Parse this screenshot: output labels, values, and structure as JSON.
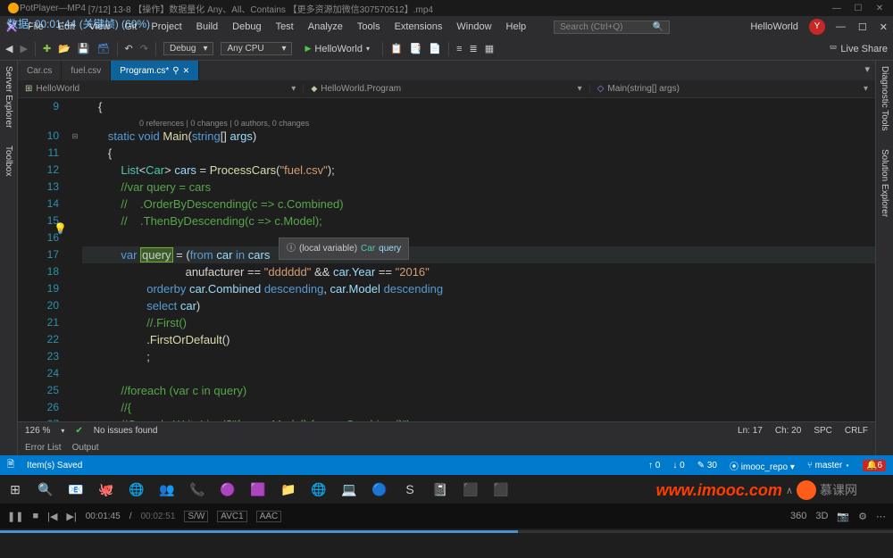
{
  "pot": {
    "app": "PotPlayer",
    "format": "MP4",
    "file": "[7/12] 13-8 【操作】数据量化 Any、All、Contains 【更多资源加微信307570512】.mp4"
  },
  "overlay": "数据: 00:01:44 (关键帧) (60%)",
  "menu": [
    "File",
    "Edit",
    "View",
    "Git",
    "Project",
    "Build",
    "Debug",
    "Test",
    "Analyze",
    "Tools",
    "Extensions",
    "Window",
    "Help"
  ],
  "search_ph": "Search (Ctrl+Q)",
  "app_name": "HelloWorld",
  "user_initial": "Y",
  "toolbar": {
    "config": "Debug",
    "platform": "Any CPU",
    "run": "HelloWorld",
    "live": "Live Share"
  },
  "side_left": [
    "Server Explorer",
    "Toolbox"
  ],
  "side_right": [
    "Diagnostic Tools",
    "Solution Explorer"
  ],
  "tabs": [
    {
      "label": "Car.cs",
      "active": false
    },
    {
      "label": "fuel.csv",
      "active": false
    },
    {
      "label": "Program.cs*",
      "active": true,
      "pinned": true
    }
  ],
  "nav": {
    "proj": "HelloWorld",
    "ns": "HelloWorld.Program",
    "member": "Main(string[] args)"
  },
  "codelens": "0 references | 0 changes | 0 authors, 0 changes",
  "lines": {
    "start": 9,
    "rows": [
      {
        "n": 9,
        "t": "{",
        "ind": 40
      },
      {
        "n": 10,
        "hint": true
      },
      {
        "n": 10,
        "tokens": [
          [
            "kw",
            "static"
          ],
          [
            "pu",
            " "
          ],
          [
            "kw",
            "void"
          ],
          [
            "pu",
            " "
          ],
          [
            "fn",
            "Main"
          ],
          [
            "pu",
            "("
          ],
          [
            "kw",
            "string"
          ],
          [
            "pu",
            "[] "
          ],
          [
            "va",
            "args"
          ],
          [
            "pu",
            ")"
          ]
        ],
        "ind": 64
      },
      {
        "n": 11,
        "t": "{",
        "ind": 64
      },
      {
        "n": 12,
        "tokens": [
          [
            "ty",
            "List"
          ],
          [
            "pu",
            "<"
          ],
          [
            "ty",
            "Car"
          ],
          [
            "pu",
            "> "
          ],
          [
            "va",
            "cars"
          ],
          [
            "pu",
            " = "
          ],
          [
            "fn",
            "ProcessCars"
          ],
          [
            "pu",
            "("
          ],
          [
            "st",
            "\"fuel.csv\""
          ],
          [
            "pu",
            ");"
          ]
        ],
        "ind": 96
      },
      {
        "n": 13,
        "tokens": [
          [
            "cm",
            "//var query = cars"
          ]
        ],
        "ind": 96
      },
      {
        "n": 14,
        "tokens": [
          [
            "cm",
            "//    .OrderByDescending(c => c.Combined)"
          ]
        ],
        "ind": 96
      },
      {
        "n": 15,
        "tokens": [
          [
            "cm",
            "//    .ThenByDescending(c => c.Model);"
          ]
        ],
        "ind": 96
      },
      {
        "n": 16,
        "t": "",
        "ind": 96
      },
      {
        "n": 17,
        "hl": true,
        "tokens": [
          [
            "kw",
            "var"
          ],
          [
            "pu",
            " "
          ],
          [
            "sel",
            "query"
          ],
          [
            "pu",
            " = ("
          ],
          [
            "kw",
            "from"
          ],
          [
            "pu",
            " "
          ],
          [
            "va",
            "car"
          ],
          [
            "pu",
            " "
          ],
          [
            "kw",
            "in"
          ],
          [
            "pu",
            " "
          ],
          [
            "va",
            "cars"
          ]
        ],
        "ind": 96
      },
      {
        "n": 18,
        "tokens": [
          [
            "pu",
            "                anufacturer == "
          ],
          [
            "st",
            "\"dddddd\""
          ],
          [
            "pu",
            " && "
          ],
          [
            "va",
            "car"
          ],
          [
            "pu",
            "."
          ],
          [
            "va",
            "Year"
          ],
          [
            "pu",
            " == "
          ],
          [
            "st",
            "\"2016\""
          ]
        ],
        "ind": 128
      },
      {
        "n": 19,
        "tokens": [
          [
            "kw",
            "orderby"
          ],
          [
            "pu",
            " "
          ],
          [
            "va",
            "car"
          ],
          [
            "pu",
            "."
          ],
          [
            "va",
            "Combined"
          ],
          [
            "pu",
            " "
          ],
          [
            "kw",
            "descending"
          ],
          [
            "pu",
            ", "
          ],
          [
            "va",
            "car"
          ],
          [
            "pu",
            "."
          ],
          [
            "va",
            "Model"
          ],
          [
            "pu",
            " "
          ],
          [
            "kw",
            "descending"
          ]
        ],
        "ind": 160
      },
      {
        "n": 20,
        "tokens": [
          [
            "kw",
            "select"
          ],
          [
            "pu",
            " "
          ],
          [
            "va",
            "car"
          ],
          [
            "pu",
            ")"
          ]
        ],
        "ind": 160
      },
      {
        "n": 21,
        "tokens": [
          [
            "cm",
            "//.First()"
          ]
        ],
        "ind": 160
      },
      {
        "n": 22,
        "tokens": [
          [
            "pu",
            "."
          ],
          [
            "fn",
            "FirstOrDefault"
          ],
          [
            "pu",
            "()"
          ]
        ],
        "ind": 160
      },
      {
        "n": 23,
        "tokens": [
          [
            "pu",
            ";"
          ]
        ],
        "ind": 160
      },
      {
        "n": 24,
        "t": "",
        "ind": 96
      },
      {
        "n": 25,
        "tokens": [
          [
            "cm",
            "//foreach (var c in query)"
          ]
        ],
        "ind": 96
      },
      {
        "n": 26,
        "tokens": [
          [
            "cm",
            "//{"
          ]
        ],
        "ind": 96
      },
      {
        "n": 27,
        "tokens": [
          [
            "cm",
            "//Console.WriteLine($\"{query.Model} {query.Combined}\");"
          ]
        ],
        "ind": 96
      }
    ]
  },
  "tooltip": {
    "kind": "(local variable)",
    "type": "Car",
    "name": "query"
  },
  "ed_status": {
    "zoom": "126 %",
    "issues": "No issues found",
    "ln": "Ln: 17",
    "ch": "Ch: 20",
    "spc": "SPC",
    "crlf": "CRLF"
  },
  "bottom_tabs": [
    "Error List",
    "Output"
  ],
  "vs_status": {
    "msg": "Item(s) Saved",
    "up": "0",
    "down": "0",
    "pencil": "30",
    "repo": "imooc_repo",
    "branch": "master",
    "bell": "6"
  },
  "task_icons": [
    "⊞",
    "🔍",
    "📧",
    "🐙",
    "🌐",
    "👥",
    "📞",
    "🟣",
    "🟪",
    "📁",
    "🌐",
    "💻",
    "🔵",
    "S",
    "📓",
    "⬛",
    "⬛"
  ],
  "watermark": {
    "url": "www.imooc.com",
    "cn": "慕课网"
  },
  "player": {
    "cur": "00:01:45",
    "total": "00:02:51",
    "codec1": "S/W",
    "codec2": "AVC1",
    "codec3": "AAC"
  }
}
